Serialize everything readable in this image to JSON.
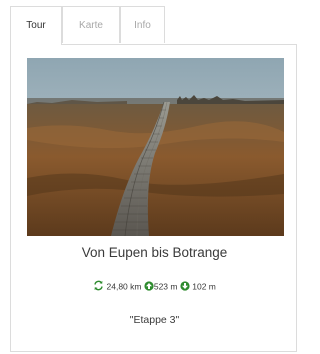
{
  "tabs": [
    {
      "label": "Tour"
    },
    {
      "label": "Karte"
    },
    {
      "label": "Info"
    }
  ],
  "tour": {
    "title": "Von Eupen bis Botrange",
    "distance": "24,80 km",
    "ascent": "523",
    "ascent_unit": "m",
    "descent": "102 m",
    "subtitle": "\"Etappe 3\""
  },
  "icons": {
    "distance": "loop-arrows-icon",
    "ascent": "arrow-up-circle-icon",
    "descent": "arrow-down-circle-icon"
  },
  "colors": {
    "icon_green": "#2e8b2e",
    "border": "#dcdcdc"
  }
}
